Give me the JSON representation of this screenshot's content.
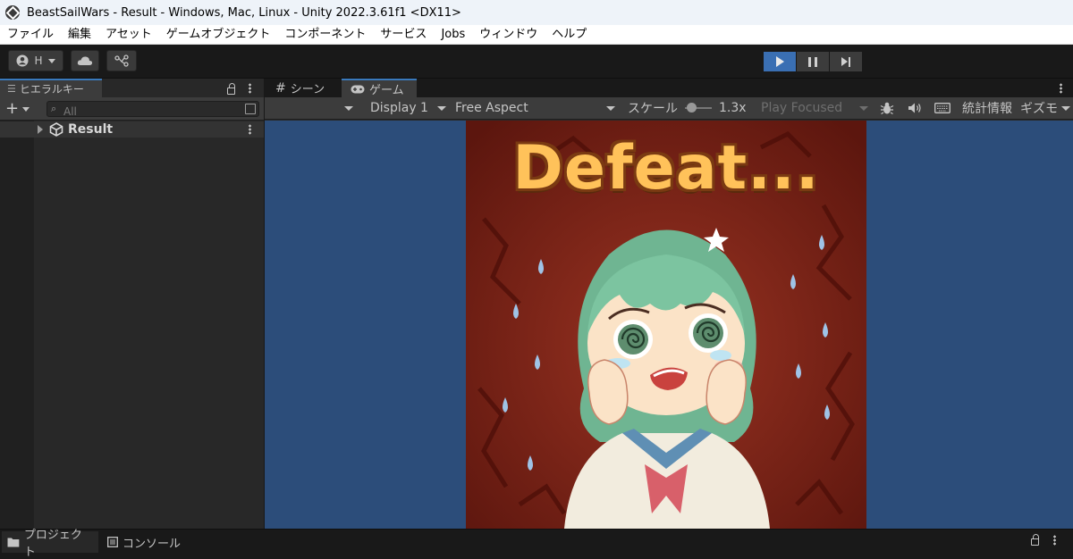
{
  "window": {
    "title": "BeastSailWars - Result - Windows, Mac, Linux - Unity 2022.3.61f1 <DX11>"
  },
  "menu": [
    "ファイル",
    "編集",
    "アセット",
    "ゲームオブジェクト",
    "コンポーネント",
    "サービス",
    "Jobs",
    "ウィンドウ",
    "ヘルプ"
  ],
  "toolbar": {
    "account_label": "H"
  },
  "hierarchy": {
    "tab_label": "ヒエラルキー",
    "search_placeholder": "All",
    "scene_name": "Result"
  },
  "game_view": {
    "scene_tab": "シーン",
    "game_tab": "ゲーム",
    "display": "Display 1",
    "aspect": "Free Aspect",
    "scale_label": "スケール",
    "scale_value": "1.3x",
    "scale_level": 0.1,
    "play_mode": "Play Focused",
    "stats_label": "統計情報",
    "gizmos_label": "ギズモ",
    "game_text": "Defeat..."
  },
  "bottom": {
    "project_tab": "プロジェクト",
    "console_tab": "コンソール"
  },
  "colors": {
    "viewport_bg": "#2c4d7a",
    "play_active": "#3a6fb3",
    "tab_accent": "#3a79bb"
  }
}
